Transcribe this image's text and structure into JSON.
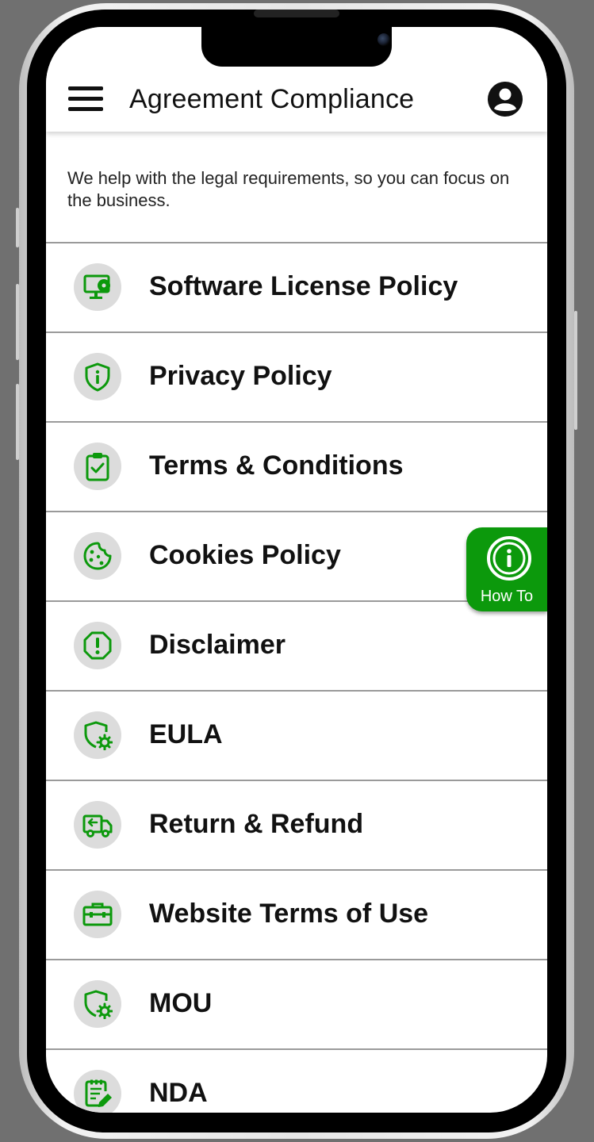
{
  "header": {
    "title": "Agreement Compliance",
    "menu_icon": "hamburger-menu-icon",
    "account_icon": "account-circle-icon"
  },
  "tagline": "We help with the legal requirements, so you can focus on the business.",
  "policies": [
    {
      "label": "Software License Policy",
      "icon": "monitor-disc-icon"
    },
    {
      "label": "Privacy Policy",
      "icon": "shield-info-icon"
    },
    {
      "label": "Terms & Conditions",
      "icon": "clipboard-check-icon"
    },
    {
      "label": "Cookies Policy",
      "icon": "cookie-icon"
    },
    {
      "label": "Disclaimer",
      "icon": "octagon-alert-icon"
    },
    {
      "label": "EULA",
      "icon": "shield-gear-icon"
    },
    {
      "label": "Return & Refund",
      "icon": "truck-return-icon"
    },
    {
      "label": "Website Terms of Use",
      "icon": "toolbox-icon"
    },
    {
      "label": "MOU",
      "icon": "shield-gear-icon"
    },
    {
      "label": "NDA",
      "icon": "document-edit-icon"
    }
  ],
  "howto": {
    "label": "How To",
    "icon": "info-icon"
  },
  "colors": {
    "accent": "#0c990c",
    "icon_bg": "#dcdcdc",
    "divider": "#9a9a9a",
    "backdrop": "#707070"
  }
}
